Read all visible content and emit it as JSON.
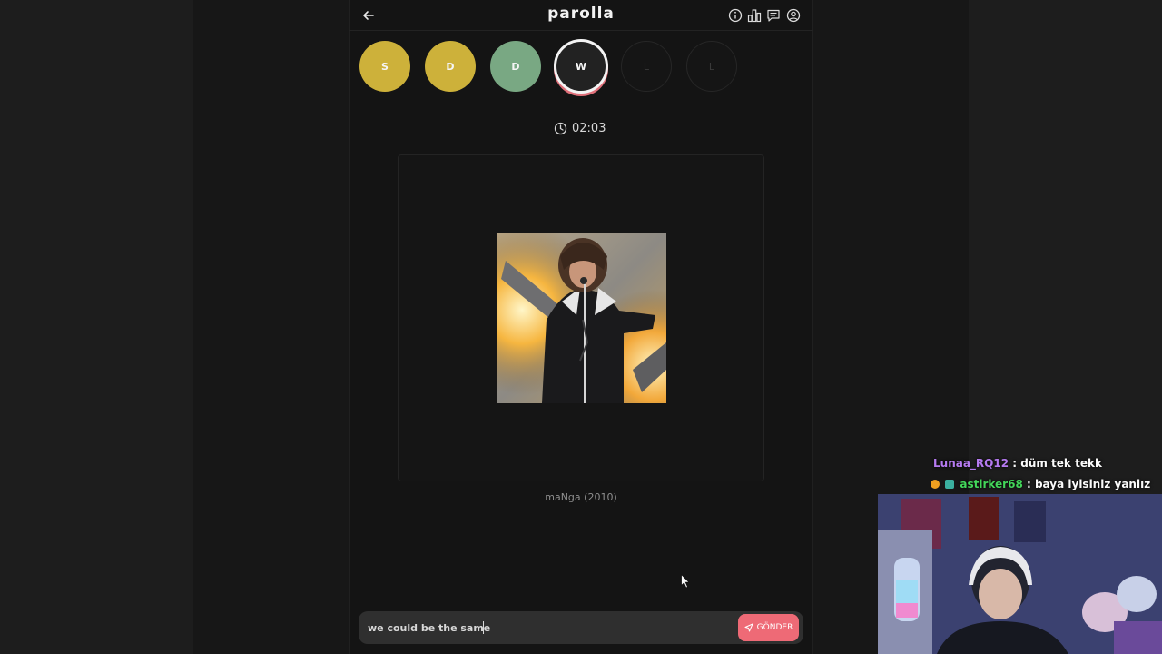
{
  "app": {
    "title": "parolla"
  },
  "header": {
    "icons": [
      "back-arrow-icon",
      "info-icon",
      "stats-icon",
      "message-icon",
      "user-icon"
    ]
  },
  "progress": {
    "letters": [
      {
        "letter": "S",
        "state": "correct-yellow"
      },
      {
        "letter": "D",
        "state": "correct-yellow"
      },
      {
        "letter": "D",
        "state": "correct-green"
      },
      {
        "letter": "W",
        "state": "current"
      },
      {
        "letter": "L",
        "state": "empty"
      },
      {
        "letter": "L",
        "state": "empty"
      }
    ]
  },
  "timer": {
    "value": "02:03"
  },
  "question": {
    "caption": "maNga (2010)"
  },
  "input": {
    "value": "we could be the same",
    "send_label": "GÖNDER"
  },
  "chat": {
    "messages": [
      {
        "user": "Lunaa_RQ12",
        "text": ": düm tek tekk"
      },
      {
        "user": "astirker68",
        "text": ": baya iyisiniz yanlız"
      }
    ]
  },
  "colors": {
    "yellow": "#cdb13a",
    "green": "#79a883",
    "accent": "#ee6a76"
  }
}
